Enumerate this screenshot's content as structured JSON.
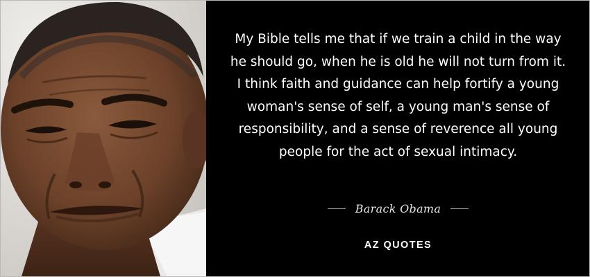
{
  "quote": {
    "text": "My Bible tells me that if we train a child in the way he should go, when he is old he will not turn from it. I think faith and guidance can help fortify a young woman's sense of self, a young man's sense of responsibility, and a sense of reverence all young people for the act of sexual intimacy.",
    "author": "Barack Obama"
  },
  "brand": {
    "name": "AZ QUOTES"
  },
  "colors": {
    "background": "#000000",
    "text": "#ffffff",
    "author_text": "#e6e6e6",
    "dash": "#bdbdbd"
  }
}
